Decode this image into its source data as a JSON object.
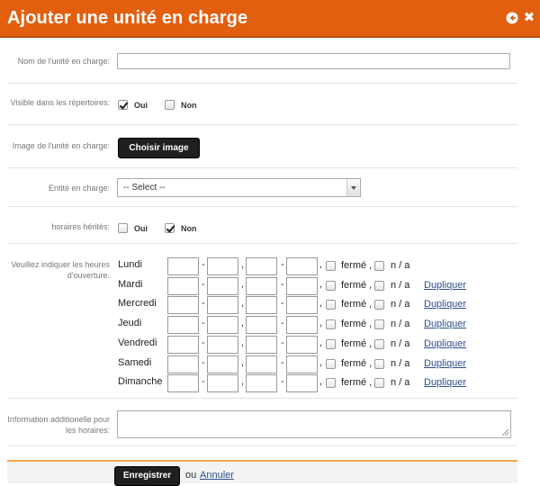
{
  "dialog": {
    "title": "Ajouter une unité en charge",
    "back_icon": "circle-arrow-left-icon",
    "close_symbol": "✖"
  },
  "form": {
    "name_label": "Nom de l'unité en charge:",
    "name_value": "",
    "visible_label": "Visible dans les répertoires:",
    "visible_yes": "Oui",
    "visible_no": "Non",
    "visible_selected": "Oui",
    "image_label": "Image de l'unité en charge:",
    "image_button": "Choisir image",
    "entity_label": "Entité en charge:",
    "entity_selected": "-- Select --",
    "inherited_label": "horaires hérités:",
    "inherited_yes": "Oui",
    "inherited_no": "Non",
    "inherited_selected": "Non",
    "hours_label": "Veuillez indiquer les heures d'ouverture.",
    "days": [
      {
        "name": "Lundi",
        "duplicate": ""
      },
      {
        "name": "Mardi",
        "duplicate": "Dupliquer"
      },
      {
        "name": "Mercredi",
        "duplicate": "Dupliquer"
      },
      {
        "name": "Jeudi",
        "duplicate": "Dupliquer"
      },
      {
        "name": "Vendredi",
        "duplicate": "Dupliquer"
      },
      {
        "name": "Samedi",
        "duplicate": "Dupliquer"
      },
      {
        "name": "Dimanche",
        "duplicate": "Dupliquer"
      }
    ],
    "time_separator": "-",
    "comma": ",",
    "closed_label": "fermé ,",
    "na_label": "n / a",
    "additional_label": "Information additionelle pour les horaires:",
    "additional_value": ""
  },
  "footer": {
    "save_button": "Enregistrer",
    "or_text": "ou",
    "cancel_link": "Annuler"
  },
  "colors": {
    "titlebar": "#e25f10",
    "accent_line": "#f0a64a",
    "link": "#2f4f8f",
    "dark_button": "#1f1f1f"
  }
}
